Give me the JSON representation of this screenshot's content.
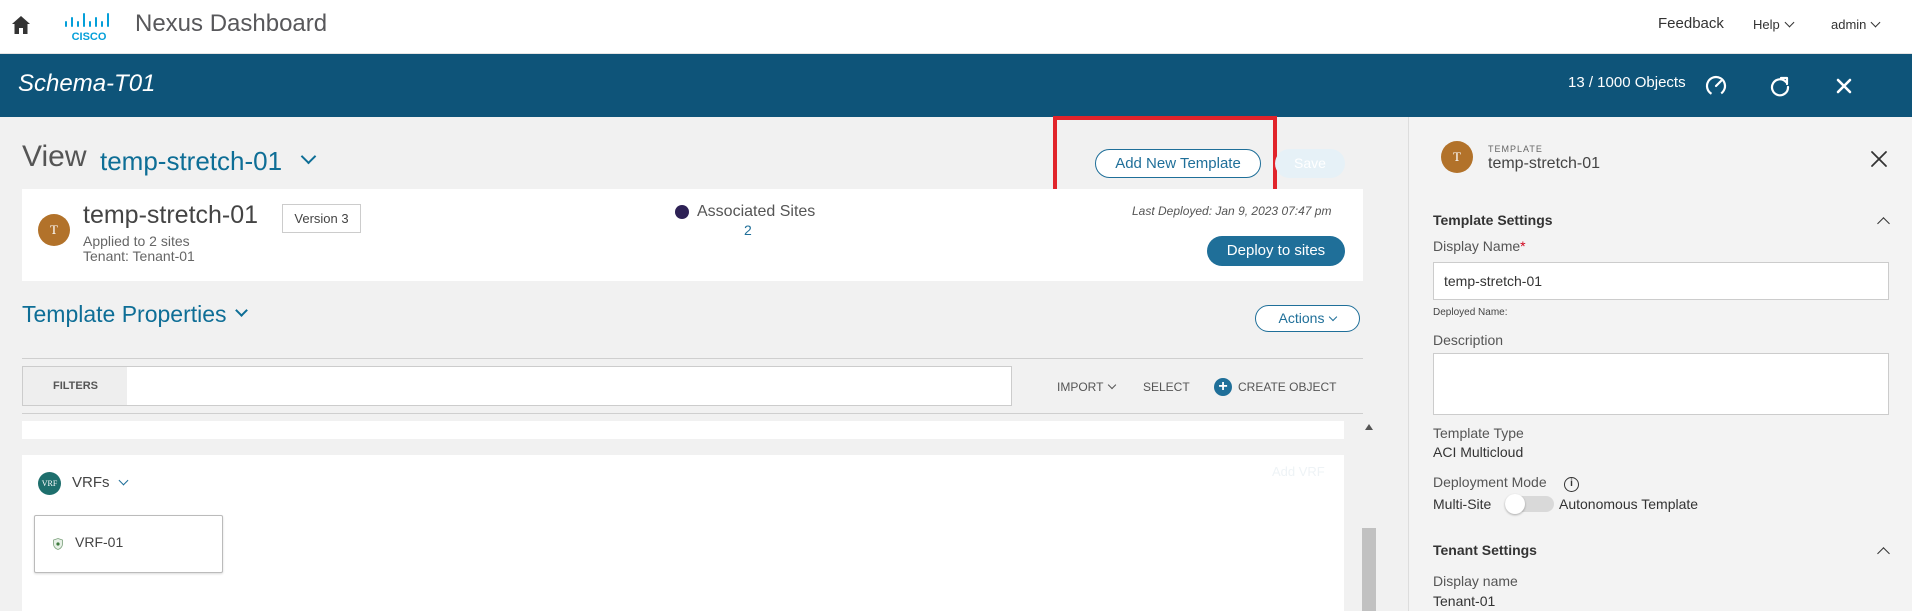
{
  "header": {
    "app_title": "Nexus Dashboard",
    "logo_text": "CISCO",
    "feedback": "Feedback",
    "help": "Help",
    "user": "admin"
  },
  "schema": {
    "title": "Schema-T01",
    "objects": "13 / 1000 Objects"
  },
  "view": {
    "label": "View",
    "template_name": "temp-stretch-01",
    "add_template_label": "Add New Template",
    "save_label": "Save"
  },
  "template_card": {
    "avatar": "T",
    "name": "temp-stretch-01",
    "version": "Version 3",
    "applied": "Applied to 2 sites",
    "tenant": "Tenant: Tenant-01",
    "associated_sites_label": "Associated Sites",
    "associated_sites_count": "2",
    "last_deployed": "Last Deployed: Jan 9, 2023 07:47 pm",
    "deploy_label": "Deploy to sites"
  },
  "properties": {
    "title": "Template Properties",
    "actions_label": "Actions"
  },
  "toolbar": {
    "filters_label": "FILTERS",
    "filters_value": "",
    "import_label": "IMPORT",
    "select_label": "SELECT",
    "create_label": "CREATE OBJECT"
  },
  "vrf_section": {
    "badge": "VRF",
    "title": "VRFs",
    "add_label": "Add VRF",
    "items": [
      {
        "label": "VRF-01"
      }
    ]
  },
  "right_panel": {
    "eyebrow": "TEMPLATE",
    "avatar": "T",
    "name": "temp-stretch-01",
    "template_settings": "Template Settings",
    "display_name_label": "Display Name",
    "display_name_value": "temp-stretch-01",
    "deployed_name_label": "Deployed Name:",
    "description_label": "Description",
    "description_value": "",
    "template_type_label": "Template Type",
    "template_type_value": "ACI Multicloud",
    "deployment_mode_label": "Deployment Mode",
    "mode_left": "Multi-Site",
    "mode_right": "Autonomous Template",
    "mode_autonomous": false,
    "tenant_settings": "Tenant Settings",
    "tenant_display_label": "Display name",
    "tenant_display_value": "Tenant-01"
  },
  "colors": {
    "brand_bar": "#0e5479",
    "accent": "#1f6f99",
    "highlight": "#e1242b"
  }
}
